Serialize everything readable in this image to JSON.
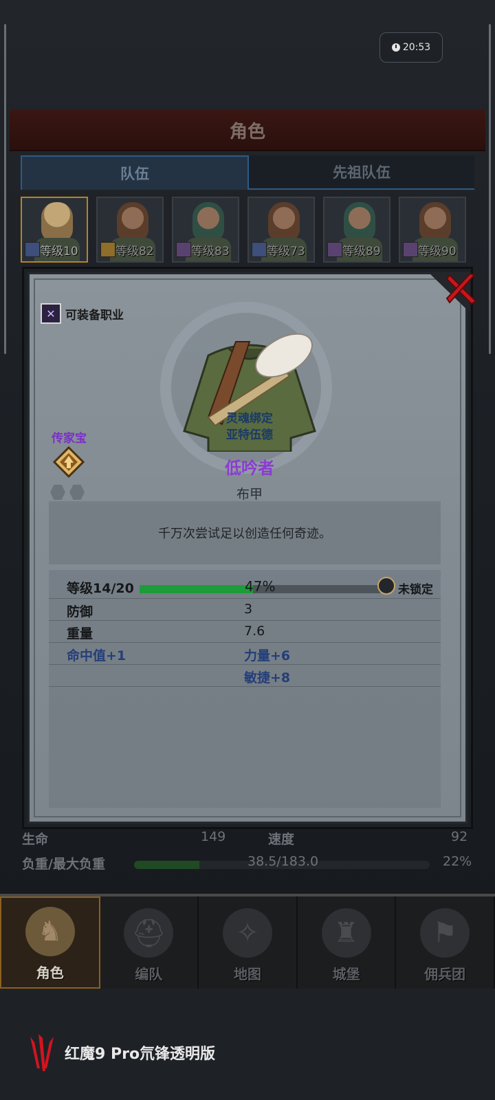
{
  "clock": "20:53",
  "header": {
    "title": "角色"
  },
  "tabs": [
    "队伍",
    "先祖队伍"
  ],
  "roster": [
    {
      "level": "等级10",
      "badge": "blue"
    },
    {
      "level": "等级82",
      "badge": "gold"
    },
    {
      "level": "等级83",
      "badge": "purple"
    },
    {
      "level": "等级73",
      "badge": "blue"
    },
    {
      "level": "等级89",
      "badge": "purple"
    },
    {
      "level": "等级90",
      "badge": "purple"
    }
  ],
  "item": {
    "equip_tag": "可装备职业",
    "heirloom": "传家宝",
    "soulbound_line1": "灵魂绑定",
    "soulbound_line2": "亚特伍德",
    "name": "低吟者",
    "type": "布甲",
    "description": "千万次尝试足以创造任何奇迹。",
    "level_label": "等级14/20",
    "level_progress": 0.47,
    "level_pct": "47%",
    "lock_label": "未锁定",
    "stats": [
      {
        "label": "防御",
        "value": "3"
      },
      {
        "label": "重量",
        "value": "7.6"
      }
    ],
    "bonuses_left": [
      "命中值+1"
    ],
    "bonuses_right": [
      "力量+6",
      "敏捷+8"
    ]
  },
  "bottom_stats": {
    "hp_label": "生命",
    "hp_value": "149",
    "speed_label": "速度",
    "speed_value": "92",
    "load_label": "负重/最大负重",
    "load_value": "38.5/183.0",
    "load_pct": "22%",
    "load_progress": 0.22
  },
  "nav": [
    "角色",
    "编队",
    "地图",
    "城堡",
    "佣兵团"
  ],
  "brand": "红魔9 Pro氘锋透明版",
  "colors": {
    "item_name": "#8b3bd3",
    "soulbound": "#1a3a66",
    "bonus": "#243e78",
    "xp_bar": "#1d9c3a",
    "close": "#c8161b"
  }
}
